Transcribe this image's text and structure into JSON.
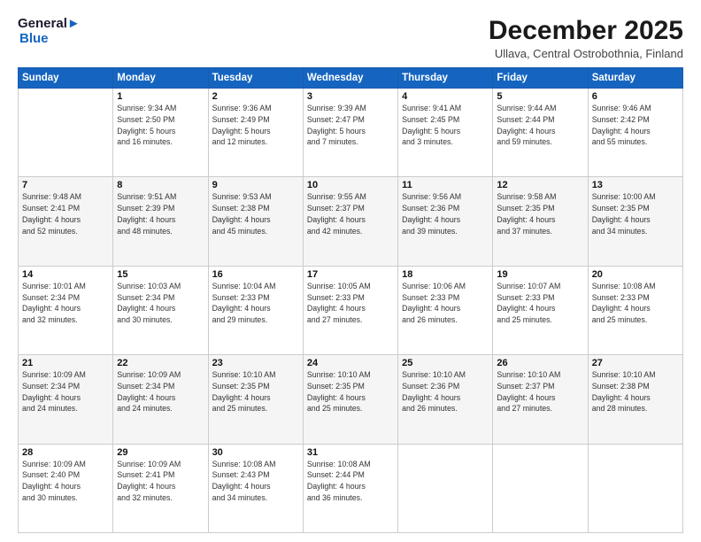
{
  "logo": {
    "line1": "General",
    "line2": "Blue"
  },
  "title": "December 2025",
  "subtitle": "Ullava, Central Ostrobothnia, Finland",
  "days_header": [
    "Sunday",
    "Monday",
    "Tuesday",
    "Wednesday",
    "Thursday",
    "Friday",
    "Saturday"
  ],
  "weeks": [
    [
      {
        "num": "",
        "info": ""
      },
      {
        "num": "1",
        "info": "Sunrise: 9:34 AM\nSunset: 2:50 PM\nDaylight: 5 hours\nand 16 minutes."
      },
      {
        "num": "2",
        "info": "Sunrise: 9:36 AM\nSunset: 2:49 PM\nDaylight: 5 hours\nand 12 minutes."
      },
      {
        "num": "3",
        "info": "Sunrise: 9:39 AM\nSunset: 2:47 PM\nDaylight: 5 hours\nand 7 minutes."
      },
      {
        "num": "4",
        "info": "Sunrise: 9:41 AM\nSunset: 2:45 PM\nDaylight: 5 hours\nand 3 minutes."
      },
      {
        "num": "5",
        "info": "Sunrise: 9:44 AM\nSunset: 2:44 PM\nDaylight: 4 hours\nand 59 minutes."
      },
      {
        "num": "6",
        "info": "Sunrise: 9:46 AM\nSunset: 2:42 PM\nDaylight: 4 hours\nand 55 minutes."
      }
    ],
    [
      {
        "num": "7",
        "info": "Sunrise: 9:48 AM\nSunset: 2:41 PM\nDaylight: 4 hours\nand 52 minutes."
      },
      {
        "num": "8",
        "info": "Sunrise: 9:51 AM\nSunset: 2:39 PM\nDaylight: 4 hours\nand 48 minutes."
      },
      {
        "num": "9",
        "info": "Sunrise: 9:53 AM\nSunset: 2:38 PM\nDaylight: 4 hours\nand 45 minutes."
      },
      {
        "num": "10",
        "info": "Sunrise: 9:55 AM\nSunset: 2:37 PM\nDaylight: 4 hours\nand 42 minutes."
      },
      {
        "num": "11",
        "info": "Sunrise: 9:56 AM\nSunset: 2:36 PM\nDaylight: 4 hours\nand 39 minutes."
      },
      {
        "num": "12",
        "info": "Sunrise: 9:58 AM\nSunset: 2:35 PM\nDaylight: 4 hours\nand 37 minutes."
      },
      {
        "num": "13",
        "info": "Sunrise: 10:00 AM\nSunset: 2:35 PM\nDaylight: 4 hours\nand 34 minutes."
      }
    ],
    [
      {
        "num": "14",
        "info": "Sunrise: 10:01 AM\nSunset: 2:34 PM\nDaylight: 4 hours\nand 32 minutes."
      },
      {
        "num": "15",
        "info": "Sunrise: 10:03 AM\nSunset: 2:34 PM\nDaylight: 4 hours\nand 30 minutes."
      },
      {
        "num": "16",
        "info": "Sunrise: 10:04 AM\nSunset: 2:33 PM\nDaylight: 4 hours\nand 29 minutes."
      },
      {
        "num": "17",
        "info": "Sunrise: 10:05 AM\nSunset: 2:33 PM\nDaylight: 4 hours\nand 27 minutes."
      },
      {
        "num": "18",
        "info": "Sunrise: 10:06 AM\nSunset: 2:33 PM\nDaylight: 4 hours\nand 26 minutes."
      },
      {
        "num": "19",
        "info": "Sunrise: 10:07 AM\nSunset: 2:33 PM\nDaylight: 4 hours\nand 25 minutes."
      },
      {
        "num": "20",
        "info": "Sunrise: 10:08 AM\nSunset: 2:33 PM\nDaylight: 4 hours\nand 25 minutes."
      }
    ],
    [
      {
        "num": "21",
        "info": "Sunrise: 10:09 AM\nSunset: 2:34 PM\nDaylight: 4 hours\nand 24 minutes."
      },
      {
        "num": "22",
        "info": "Sunrise: 10:09 AM\nSunset: 2:34 PM\nDaylight: 4 hours\nand 24 minutes."
      },
      {
        "num": "23",
        "info": "Sunrise: 10:10 AM\nSunset: 2:35 PM\nDaylight: 4 hours\nand 25 minutes."
      },
      {
        "num": "24",
        "info": "Sunrise: 10:10 AM\nSunset: 2:35 PM\nDaylight: 4 hours\nand 25 minutes."
      },
      {
        "num": "25",
        "info": "Sunrise: 10:10 AM\nSunset: 2:36 PM\nDaylight: 4 hours\nand 26 minutes."
      },
      {
        "num": "26",
        "info": "Sunrise: 10:10 AM\nSunset: 2:37 PM\nDaylight: 4 hours\nand 27 minutes."
      },
      {
        "num": "27",
        "info": "Sunrise: 10:10 AM\nSunset: 2:38 PM\nDaylight: 4 hours\nand 28 minutes."
      }
    ],
    [
      {
        "num": "28",
        "info": "Sunrise: 10:09 AM\nSunset: 2:40 PM\nDaylight: 4 hours\nand 30 minutes."
      },
      {
        "num": "29",
        "info": "Sunrise: 10:09 AM\nSunset: 2:41 PM\nDaylight: 4 hours\nand 32 minutes."
      },
      {
        "num": "30",
        "info": "Sunrise: 10:08 AM\nSunset: 2:43 PM\nDaylight: 4 hours\nand 34 minutes."
      },
      {
        "num": "31",
        "info": "Sunrise: 10:08 AM\nSunset: 2:44 PM\nDaylight: 4 hours\nand 36 minutes."
      },
      {
        "num": "",
        "info": ""
      },
      {
        "num": "",
        "info": ""
      },
      {
        "num": "",
        "info": ""
      }
    ]
  ]
}
